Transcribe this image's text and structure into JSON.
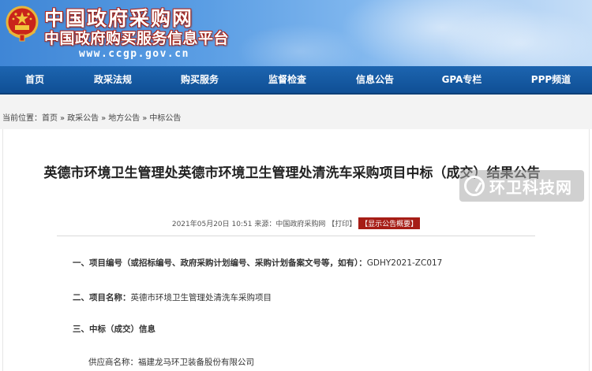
{
  "header": {
    "title_main": "中国政府采购网",
    "title_sub": "中国政府购买服务信息平台",
    "url": "www.ccgp.gov.cn",
    "emblem_icon": "national-emblem-icon"
  },
  "nav": {
    "items": [
      {
        "label": "首页"
      },
      {
        "label": "政采法规"
      },
      {
        "label": "购买服务"
      },
      {
        "label": "监督检查"
      },
      {
        "label": "信息公告"
      },
      {
        "label": "GPA专栏"
      },
      {
        "label": "PPP频道"
      }
    ]
  },
  "breadcrumb": {
    "prefix": "当前位置：",
    "items": [
      "首页",
      "政采公告",
      "地方公告",
      "中标公告"
    ],
    "separator": "»"
  },
  "article": {
    "title": "英德市环境卫生管理处英德市环境卫生管理处清洗车采购项目中标（成交）结果公告",
    "meta": {
      "datetime": "2021年05月20日 10:51",
      "source_label": "来源：",
      "source": "中国政府采购网",
      "print": "【打印】",
      "summary_button": "【显示公告概要】"
    },
    "lines": [
      {
        "label": "一、项目编号（或招标编号、政府采购计划编号、采购计划备案文号等，如有）：",
        "value": "GDHY2021-ZC017"
      },
      {
        "label": "二、项目名称：",
        "value": "英德市环境卫生管理处清洗车采购项目"
      },
      {
        "label": "三、中标（成交）信息",
        "value": ""
      },
      {
        "label": "供应商名称：",
        "value": "福建龙马环卫装备股份有限公司"
      }
    ]
  },
  "watermark": {
    "text": "环卫科技网",
    "icon": "watermark-logo-icon"
  },
  "colors": {
    "nav_bg": "#1560ac",
    "summary_bg": "#a61d16",
    "title_outline": "#b3241a"
  }
}
